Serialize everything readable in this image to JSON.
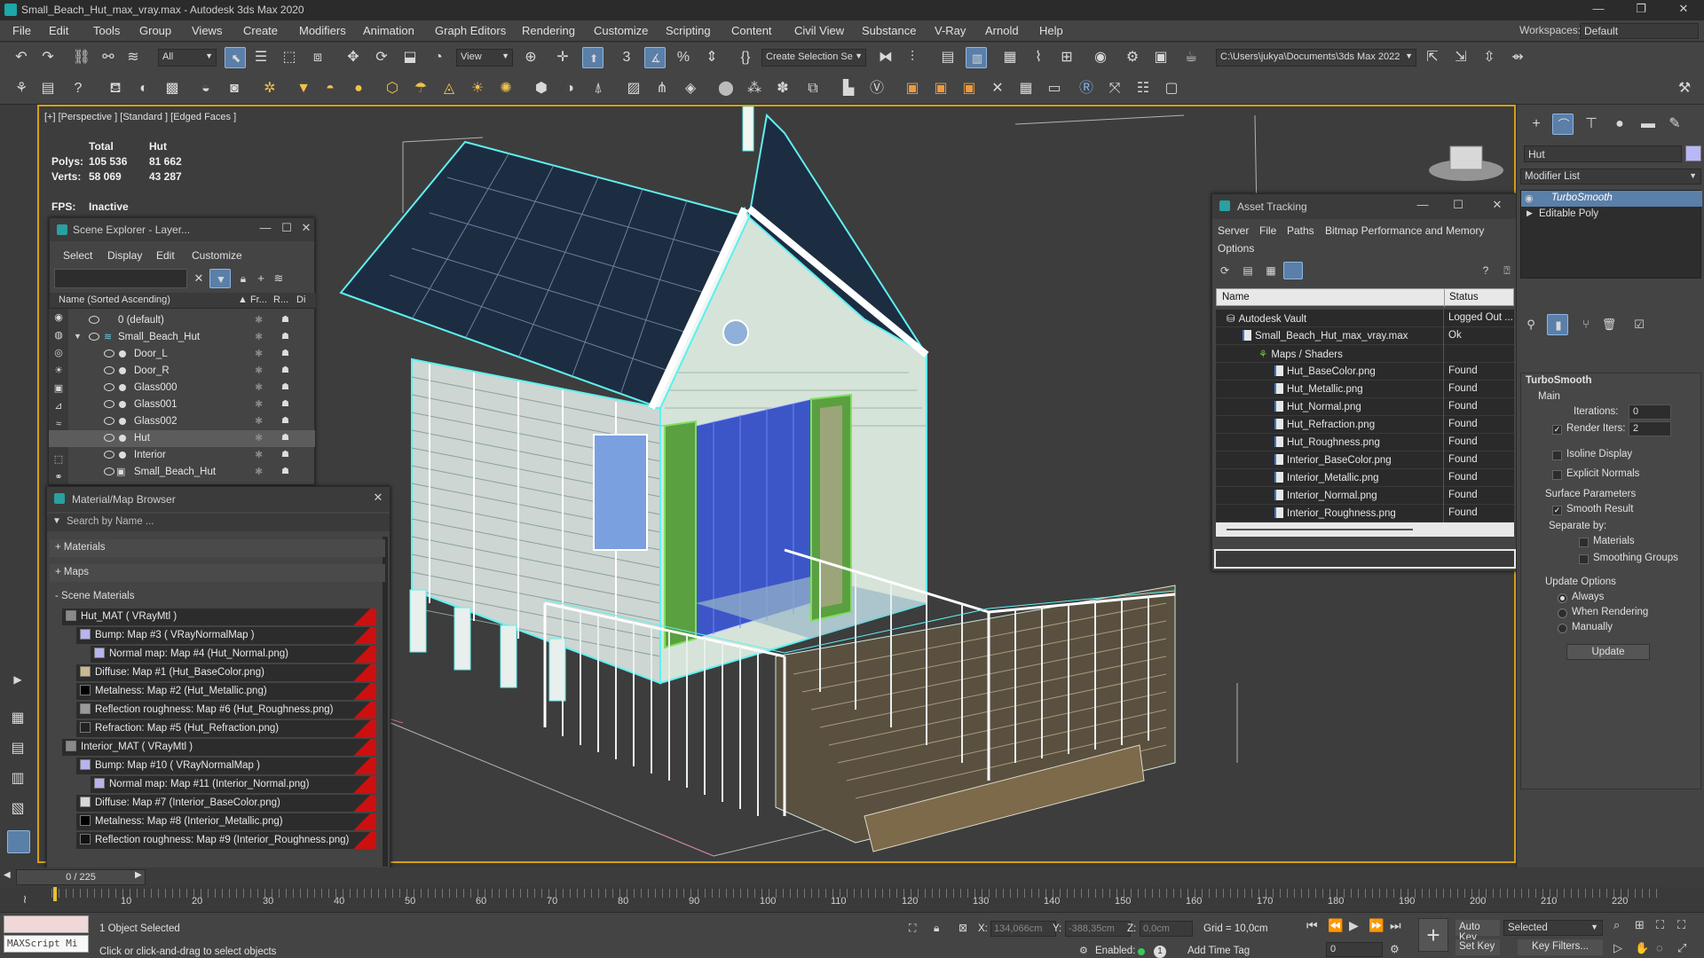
{
  "window": {
    "title": "Small_Beach_Hut_max_vray.max - Autodesk 3ds Max 2020",
    "controls": [
      "—",
      "❐",
      "✕"
    ]
  },
  "menu": {
    "items": [
      "File",
      "Edit",
      "Tools",
      "Group",
      "Views",
      "Create",
      "Modifiers",
      "Animation",
      "Graph Editors",
      "Rendering",
      "Customize",
      "Scripting",
      "Content",
      "Civil View",
      "Substance",
      "V-Ray",
      "Arnold",
      "Help"
    ],
    "workspaces_label": "Workspaces:",
    "workspaces_value": "Default"
  },
  "toolbar": {
    "selection_filter": "All",
    "ref_coord": "View",
    "named_selection": "Create Selection Se",
    "project_path": "C:\\Users\\jukya\\Documents\\3ds Max 2022"
  },
  "viewport": {
    "label": "[+] [Perspective ] [Standard ] [Edged Faces ]",
    "stats": {
      "col_total": "Total",
      "col_sel": "Hut",
      "polys_label": "Polys:",
      "polys_total": "105 536",
      "polys_sel": "81 662",
      "verts_label": "Verts:",
      "verts_total": "58 069",
      "verts_sel": "43 287",
      "fps_label": "FPS:",
      "fps_value": "Inactive"
    }
  },
  "scene_explorer": {
    "title": "Scene Explorer - Layer...",
    "menu": [
      "Select",
      "Display",
      "Edit",
      "Customize"
    ],
    "col_name": "Name (Sorted Ascending)",
    "col_fr": "▲ Fr...",
    "col_r": "R...",
    "col_di": "Di",
    "rows": [
      {
        "name": "0 (default)",
        "indent": 0
      },
      {
        "name": "Small_Beach_Hut",
        "indent": 0
      },
      {
        "name": "Door_L",
        "indent": 1
      },
      {
        "name": "Door_R",
        "indent": 1
      },
      {
        "name": "Glass000",
        "indent": 1
      },
      {
        "name": "Glass001",
        "indent": 1
      },
      {
        "name": "Glass002",
        "indent": 1
      },
      {
        "name": "Hut",
        "indent": 1
      },
      {
        "name": "Interior",
        "indent": 1
      },
      {
        "name": "Small_Beach_Hut",
        "indent": 1
      }
    ]
  },
  "material_browser": {
    "title": "Material/Map Browser",
    "search_placeholder": "Search by Name ...",
    "sections": [
      "+ Materials",
      "+ Maps",
      "- Scene Materials"
    ],
    "rows": [
      {
        "text": "Hut_MAT  ( VRayMtl )",
        "level": 0,
        "swatch": "#8a8a8a"
      },
      {
        "text": "Bump: Map #3  ( VRayNormalMap )",
        "level": 1,
        "swatch": "#b7b4ee"
      },
      {
        "text": "Normal map: Map #4 (Hut_Normal.png)",
        "level": 2,
        "swatch": "#b7b4ee"
      },
      {
        "text": "Diffuse: Map #1 (Hut_BaseColor.png)",
        "level": 1,
        "swatch": "#c9b98e"
      },
      {
        "text": "Metalness: Map #2 (Hut_Metallic.png)",
        "level": 1,
        "swatch": "#000000"
      },
      {
        "text": "Reflection roughness: Map #6 (Hut_Roughness.png)",
        "level": 1,
        "swatch": "#9a9a9a"
      },
      {
        "text": "Refraction: Map #5 (Hut_Refraction.png)",
        "level": 1,
        "swatch": "#222222"
      },
      {
        "text": "Interior_MAT  ( VRayMtl )",
        "level": 0,
        "swatch": "#8a8a8a"
      },
      {
        "text": "Bump: Map #10  ( VRayNormalMap )",
        "level": 1,
        "swatch": "#b7b4ee"
      },
      {
        "text": "Normal map: Map #11 (Interior_Normal.png)",
        "level": 2,
        "swatch": "#b7b4ee"
      },
      {
        "text": "Diffuse: Map #7 (Interior_BaseColor.png)",
        "level": 1,
        "swatch": "#d8d8d8"
      },
      {
        "text": "Metalness: Map #8 (Interior_Metallic.png)",
        "level": 1,
        "swatch": "#000000"
      },
      {
        "text": "Reflection roughness: Map #9 (Interior_Roughness.png)",
        "level": 1,
        "swatch": "#111111"
      }
    ]
  },
  "asset_tracking": {
    "title": "Asset Tracking",
    "menu": [
      "Server",
      "File",
      "Paths",
      "Bitmap Performance and Memory",
      "Options"
    ],
    "col_name": "Name",
    "col_status": "Status",
    "rows": [
      {
        "name": "Autodesk Vault",
        "status": "Logged Out ...",
        "level": 0
      },
      {
        "name": "Small_Beach_Hut_max_vray.max",
        "status": "Ok",
        "level": 1
      },
      {
        "name": "Maps / Shaders",
        "status": "",
        "level": 2
      },
      {
        "name": "Hut_BaseColor.png",
        "status": "Found",
        "level": 3
      },
      {
        "name": "Hut_Metallic.png",
        "status": "Found",
        "level": 3
      },
      {
        "name": "Hut_Normal.png",
        "status": "Found",
        "level": 3
      },
      {
        "name": "Hut_Refraction.png",
        "status": "Found",
        "level": 3
      },
      {
        "name": "Hut_Roughness.png",
        "status": "Found",
        "level": 3
      },
      {
        "name": "Interior_BaseColor.png",
        "status": "Found",
        "level": 3
      },
      {
        "name": "Interior_Metallic.png",
        "status": "Found",
        "level": 3
      },
      {
        "name": "Interior_Normal.png",
        "status": "Found",
        "level": 3
      },
      {
        "name": "Interior_Roughness.png",
        "status": "Found",
        "level": 3
      }
    ]
  },
  "command_panel": {
    "object_name": "Hut",
    "modifier_list": "Modifier List",
    "stack": [
      "TurboSmooth",
      "Editable Poly"
    ],
    "rollout_title": "TurboSmooth",
    "main_label": "Main",
    "iterations_label": "Iterations:",
    "iterations_value": "0",
    "render_iters_label": "Render Iters:",
    "render_iters_value": "2",
    "isoline": "Isoline Display",
    "explicit_normals": "Explicit Normals",
    "surface_params": "Surface Parameters",
    "smooth_result": "Smooth Result",
    "separate_by": "Separate by:",
    "materials": "Materials",
    "smoothing_groups": "Smoothing Groups",
    "update_options": "Update Options",
    "always": "Always",
    "when_rendering": "When Rendering",
    "manually": "Manually",
    "update_button": "Update"
  },
  "timeline": {
    "frame_counter": "0 / 225",
    "ticks": [
      "10",
      "20",
      "30",
      "40",
      "50",
      "60",
      "70",
      "80",
      "90",
      "100",
      "110",
      "120",
      "130",
      "140",
      "150",
      "160",
      "170",
      "180",
      "190",
      "200",
      "210",
      "220"
    ]
  },
  "status": {
    "maxscript": "MAXScript Mi",
    "selection": "1 Object Selected",
    "prompt": "Click or click-and-drag to select objects",
    "x_label": "X:",
    "x_value": "134,066cm",
    "y_label": "Y:",
    "y_value": "-388,35cm",
    "z_label": "Z:",
    "z_value": "0,0cm",
    "grid": "Grid = 10,0cm",
    "enabled": "Enabled:",
    "add_time_tag": "Add Time Tag",
    "auto_key": "Auto Key",
    "set_key": "Set Key",
    "selected": "Selected",
    "key_filters": "Key Filters...",
    "frame": "0"
  },
  "colors": {
    "accent": "#5a7fa8",
    "viewport_border": "#d4a018",
    "wire_cyan": "#5ff0f0",
    "roof": "#1c2d42"
  }
}
